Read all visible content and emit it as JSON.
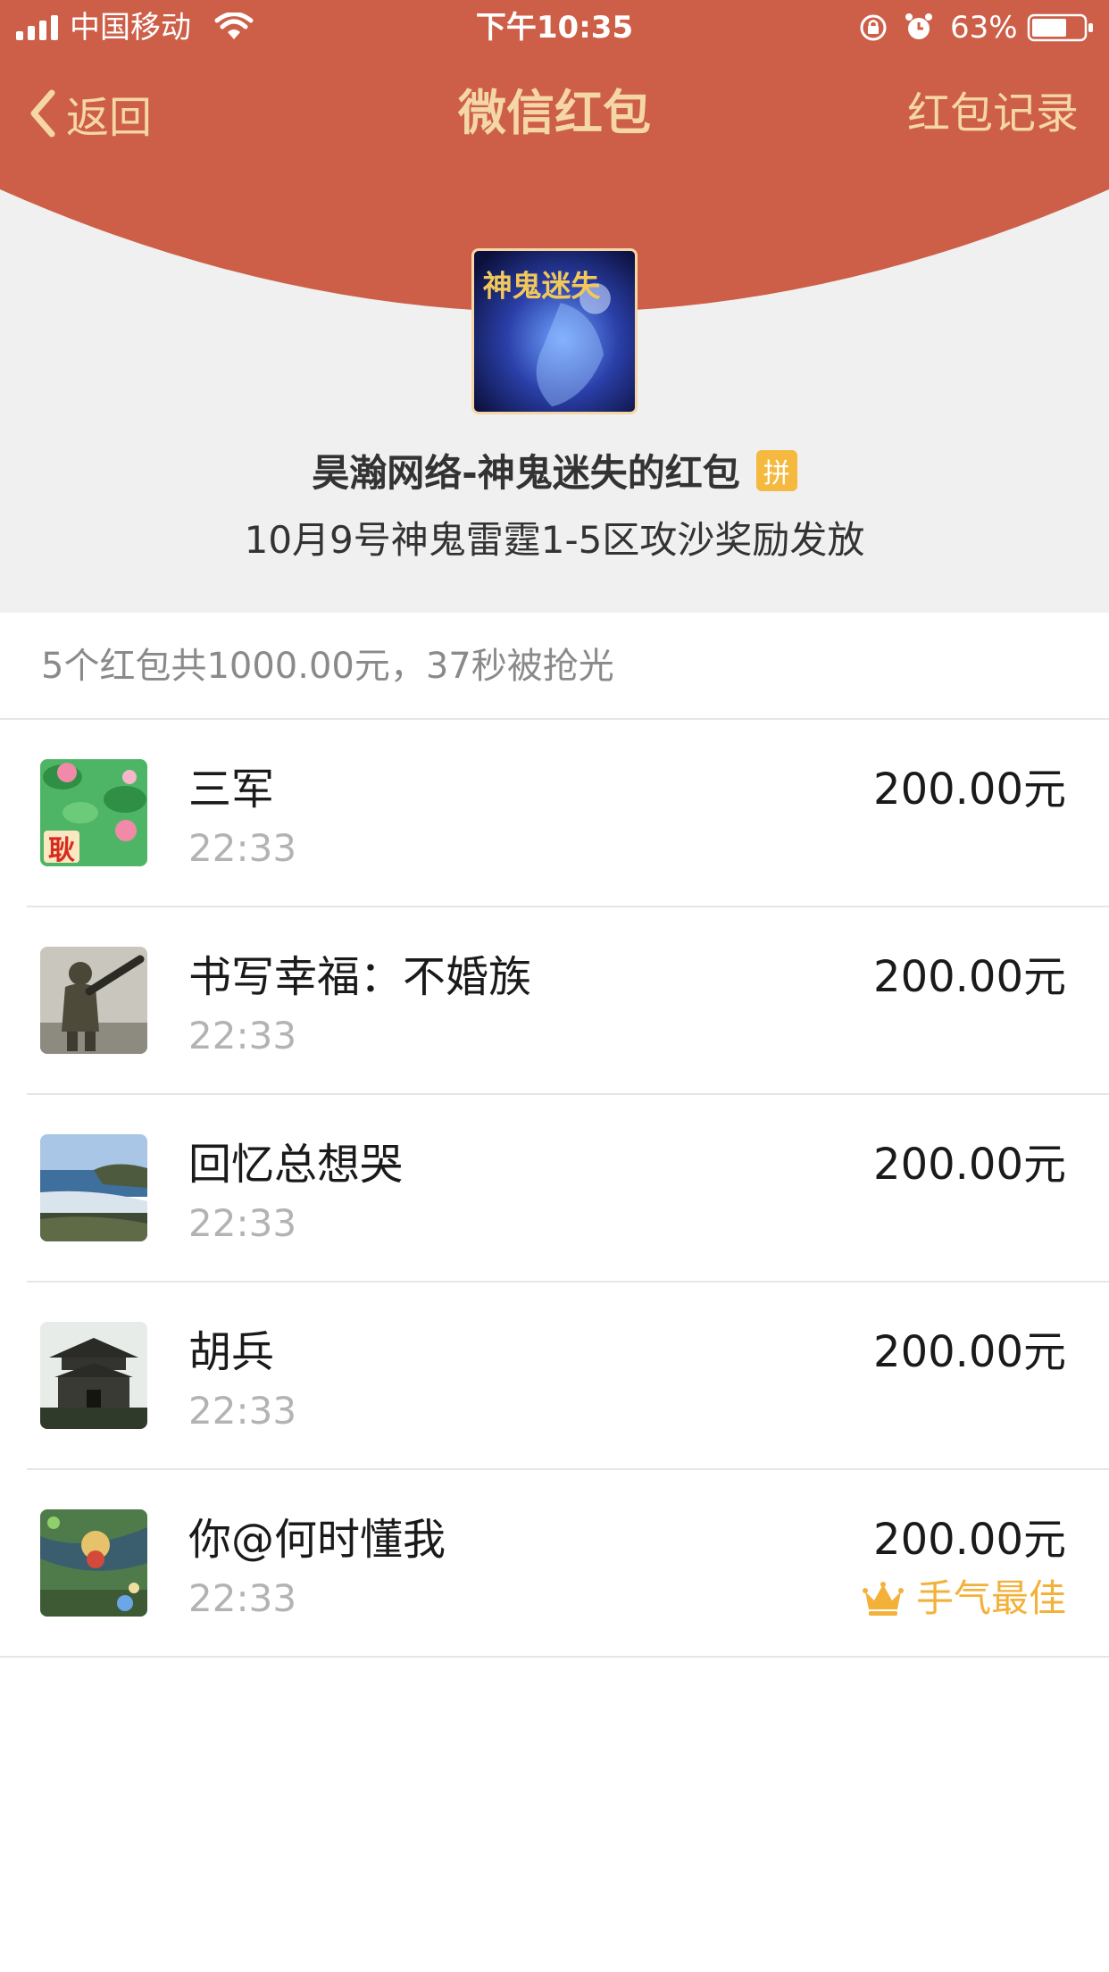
{
  "status_bar": {
    "carrier": "中国移动",
    "time": "下午10:35",
    "battery": "63%"
  },
  "nav": {
    "back_label": "返回",
    "title": "微信红包",
    "record_label": "红包记录"
  },
  "sender": {
    "name": "昊瀚网络-神鬼迷失的红包",
    "badge": "拼",
    "greeting": "10月9号神鬼雷霆1-5区攻沙奖励发放",
    "avatar_text": "神鬼迷失"
  },
  "summary": "5个红包共1000.00元，37秒被抢光",
  "recipients": [
    {
      "name": "三军",
      "time": "22:33",
      "amount": "200.00元",
      "avatar": "lotus-avatar-image",
      "avatar_char": "耿"
    },
    {
      "name": "书写幸福：不婚族",
      "time": "22:33",
      "amount": "200.00元",
      "avatar": "soldier-avatar-image"
    },
    {
      "name": "回忆总想哭",
      "time": "22:33",
      "amount": "200.00元",
      "avatar": "seaside-avatar-image"
    },
    {
      "name": "胡兵",
      "time": "22:33",
      "amount": "200.00元",
      "avatar": "tower-avatar-image"
    },
    {
      "name": "你@何时懂我",
      "time": "22:33",
      "amount": "200.00元",
      "avatar": "game-avatar-image",
      "best_luck": "手气最佳"
    }
  ],
  "colors": {
    "header_red": "#cd5f48",
    "nav_text_gold": "#f5d7a7",
    "badge_yellow": "#f4b93e",
    "best_luck_gold": "#f4b13a",
    "background_gray": "#f0f0f0"
  },
  "icons": [
    "signal-icon",
    "wifi-icon",
    "lock-rotation-icon",
    "alarm-icon",
    "battery-icon",
    "back-chevron-icon",
    "crown-icon"
  ]
}
